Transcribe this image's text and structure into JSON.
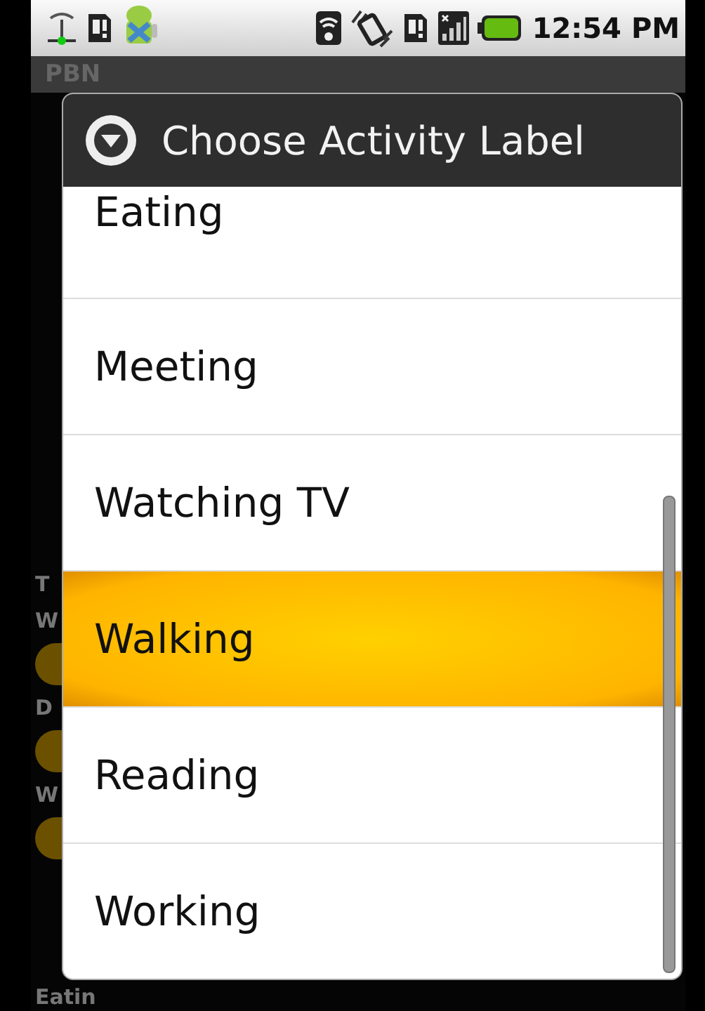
{
  "status_bar": {
    "time": "12:54 PM"
  },
  "app": {
    "title": "PBN",
    "background_labels": [
      "T",
      "W",
      "D",
      "W"
    ],
    "bottom_label": "Eatin"
  },
  "dialog": {
    "title": "Choose Activity Label",
    "items": [
      {
        "label": "Eating",
        "selected": false
      },
      {
        "label": "Meeting",
        "selected": false
      },
      {
        "label": "Watching TV",
        "selected": false
      },
      {
        "label": "Walking",
        "selected": true
      },
      {
        "label": "Reading",
        "selected": false
      },
      {
        "label": "Working",
        "selected": false
      }
    ]
  }
}
